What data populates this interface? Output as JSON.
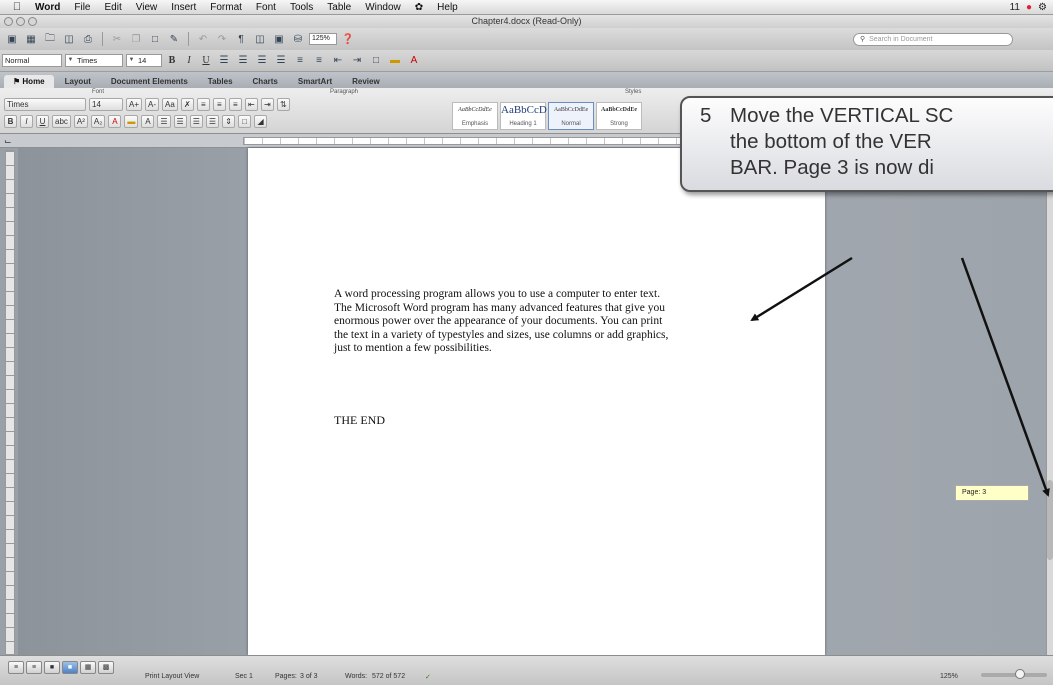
{
  "menubar": {
    "items": [
      "Word",
      "File",
      "Edit",
      "View",
      "Insert",
      "Format",
      "Font",
      "Tools",
      "Table",
      "Window",
      "Help"
    ],
    "status_indicator": "11"
  },
  "window": {
    "title": "Chapter4.docx (Read-Only)"
  },
  "toolbar": {
    "zoom": "125%",
    "search_placeholder": "Search in Document"
  },
  "formatting": {
    "style": "Normal",
    "font": "Times",
    "size": "14"
  },
  "ribbon": {
    "tabs": [
      "Home",
      "Layout",
      "Document Elements",
      "Tables",
      "Charts",
      "SmartArt",
      "Review"
    ],
    "active_tab": "Home",
    "groups": {
      "font": "Font",
      "paragraph": "Paragraph",
      "styles": "Styles"
    },
    "font_name": "Times",
    "font_size": "14",
    "styles": [
      {
        "sample": "AaBbCcDdEe",
        "name": "Emphasis"
      },
      {
        "sample": "AaBbCcD",
        "name": "Heading 1"
      },
      {
        "sample": "AaBbCcDdEe",
        "name": "Normal"
      },
      {
        "sample": "AaBbCcDdEe",
        "name": "Strong"
      }
    ]
  },
  "document": {
    "lines": [
      "A word processing program allows you to use a computer to enter text.",
      "The Microsoft Word program has many advanced features that give you",
      "enormous power over the appearance of your documents.  You can print",
      "the text in a variety of typestyles and sizes, use columns or add graphics,",
      "just to mention a few possibilities."
    ],
    "end_text": "THE END"
  },
  "page_tooltip": "Page: 3",
  "callout": {
    "number": "5",
    "lines": [
      "Move the VERTICAL SC",
      "the bottom of the VER",
      "BAR.  Page 3 is now di"
    ]
  },
  "statusbar": {
    "view": "Print Layout View",
    "section": "Sec    1",
    "pages_label": "Pages:",
    "pages_value": "3 of 3",
    "words_label": "Words:",
    "words_value": "572 of 572",
    "zoom": "125%",
    "zoom_level_percent": 125
  },
  "colors": {
    "workspace": "#9aa0a8",
    "callout_border": "#555555",
    "tooltip": "#ffffc8"
  }
}
